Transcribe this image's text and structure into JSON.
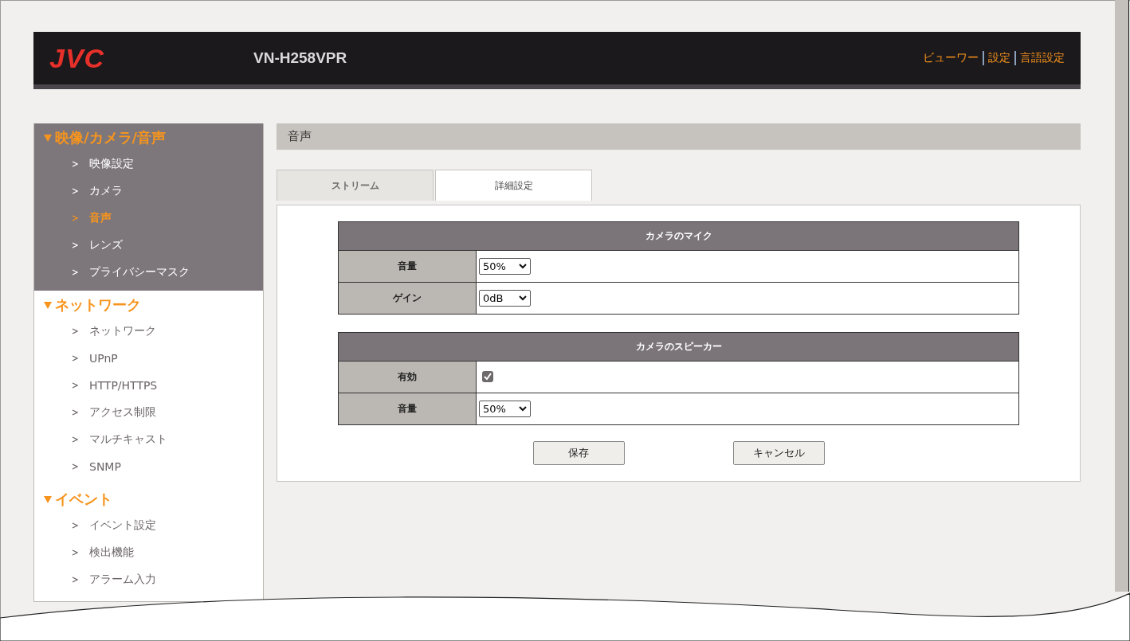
{
  "header": {
    "logo": "JVC",
    "model": "VN-H258VPR",
    "links": [
      "ビューワー",
      "設定",
      "言語設定"
    ]
  },
  "sidebar": {
    "sections": [
      {
        "title": "映像/カメラ/音声",
        "active": true,
        "items": [
          {
            "label": "映像設定",
            "selected": false
          },
          {
            "label": "カメラ",
            "selected": false
          },
          {
            "label": "音声",
            "selected": true
          },
          {
            "label": "レンズ",
            "selected": false
          },
          {
            "label": "プライバシーマスク",
            "selected": false
          }
        ]
      },
      {
        "title": "ネットワーク",
        "active": false,
        "items": [
          {
            "label": "ネットワーク",
            "selected": false
          },
          {
            "label": "UPnP",
            "selected": false
          },
          {
            "label": "HTTP/HTTPS",
            "selected": false
          },
          {
            "label": "アクセス制限",
            "selected": false
          },
          {
            "label": "マルチキャスト",
            "selected": false
          },
          {
            "label": "SNMP",
            "selected": false
          }
        ]
      },
      {
        "title": "イベント",
        "active": false,
        "items": [
          {
            "label": "イベント設定",
            "selected": false
          },
          {
            "label": "検出機能",
            "selected": false
          },
          {
            "label": "アラーム入力",
            "selected": false
          }
        ]
      }
    ]
  },
  "page_title": "音声",
  "tabs": [
    {
      "label": "ストリーム",
      "selected": false
    },
    {
      "label": "詳細設定",
      "selected": true
    }
  ],
  "tables": [
    {
      "title": "カメラのマイク",
      "rows": [
        {
          "label": "音量",
          "kind": "select",
          "value": "50%"
        },
        {
          "label": "ゲイン",
          "kind": "select",
          "value": "0dB"
        }
      ]
    },
    {
      "title": "カメラのスピーカー",
      "rows": [
        {
          "label": "有効",
          "kind": "checkbox",
          "checked": true
        },
        {
          "label": "音量",
          "kind": "select",
          "value": "50%"
        }
      ]
    }
  ],
  "buttons": [
    "保存",
    "キャンセル"
  ]
}
